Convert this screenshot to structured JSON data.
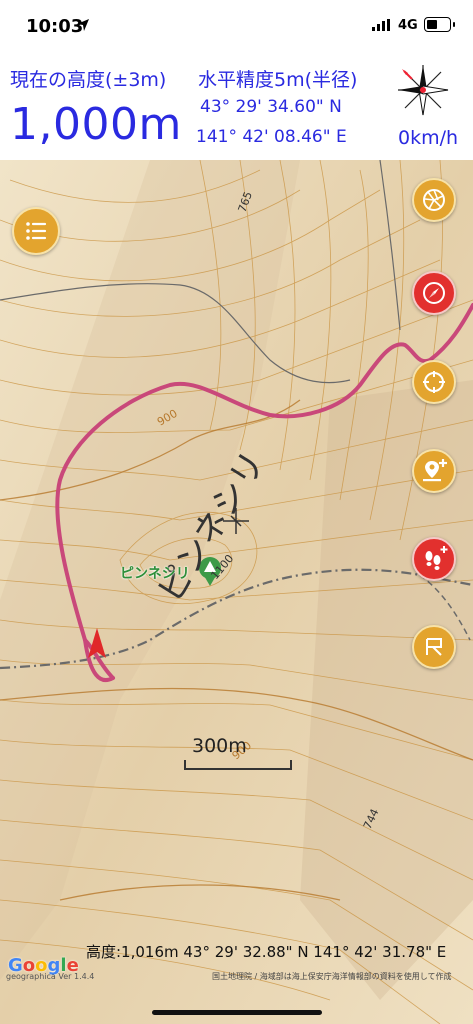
{
  "status_bar": {
    "time": "10:03",
    "network": "4G"
  },
  "hud": {
    "altitude_label": "現在の高度(±3m)",
    "altitude_value": "1,000m",
    "accuracy_label": "水平精度5m(半径)",
    "latitude": "43° 29' 34.60\" N",
    "longitude": "141° 42' 08.46\" E",
    "speed": "0km/h",
    "compass_icon": "compass-rose-icon"
  },
  "map": {
    "peak_name": "ピンネシリ",
    "contour_labels": [
      "765",
      "900",
      "1100",
      "900",
      "744"
    ],
    "scale_label": "300m",
    "cursor_coords": "高度:1,016m  43° 29' 32.88\" N 141° 42' 31.78\" E",
    "google_logo": "Google",
    "app_version": "geographica Ver 1.4.4",
    "attribution": "国土地理院 / 海域部は海上保安庁海洋情報部の資料を使用して作成",
    "colors": {
      "track": "#c9487a",
      "contour": "#c98a3a",
      "road": "#6a6a6a"
    }
  },
  "buttons": {
    "menu": "list-menu-icon",
    "right": [
      "aperture-icon",
      "compass-icon",
      "crosshair-icon",
      "add-point-icon",
      "add-footprint-icon",
      "flag-icon"
    ]
  }
}
